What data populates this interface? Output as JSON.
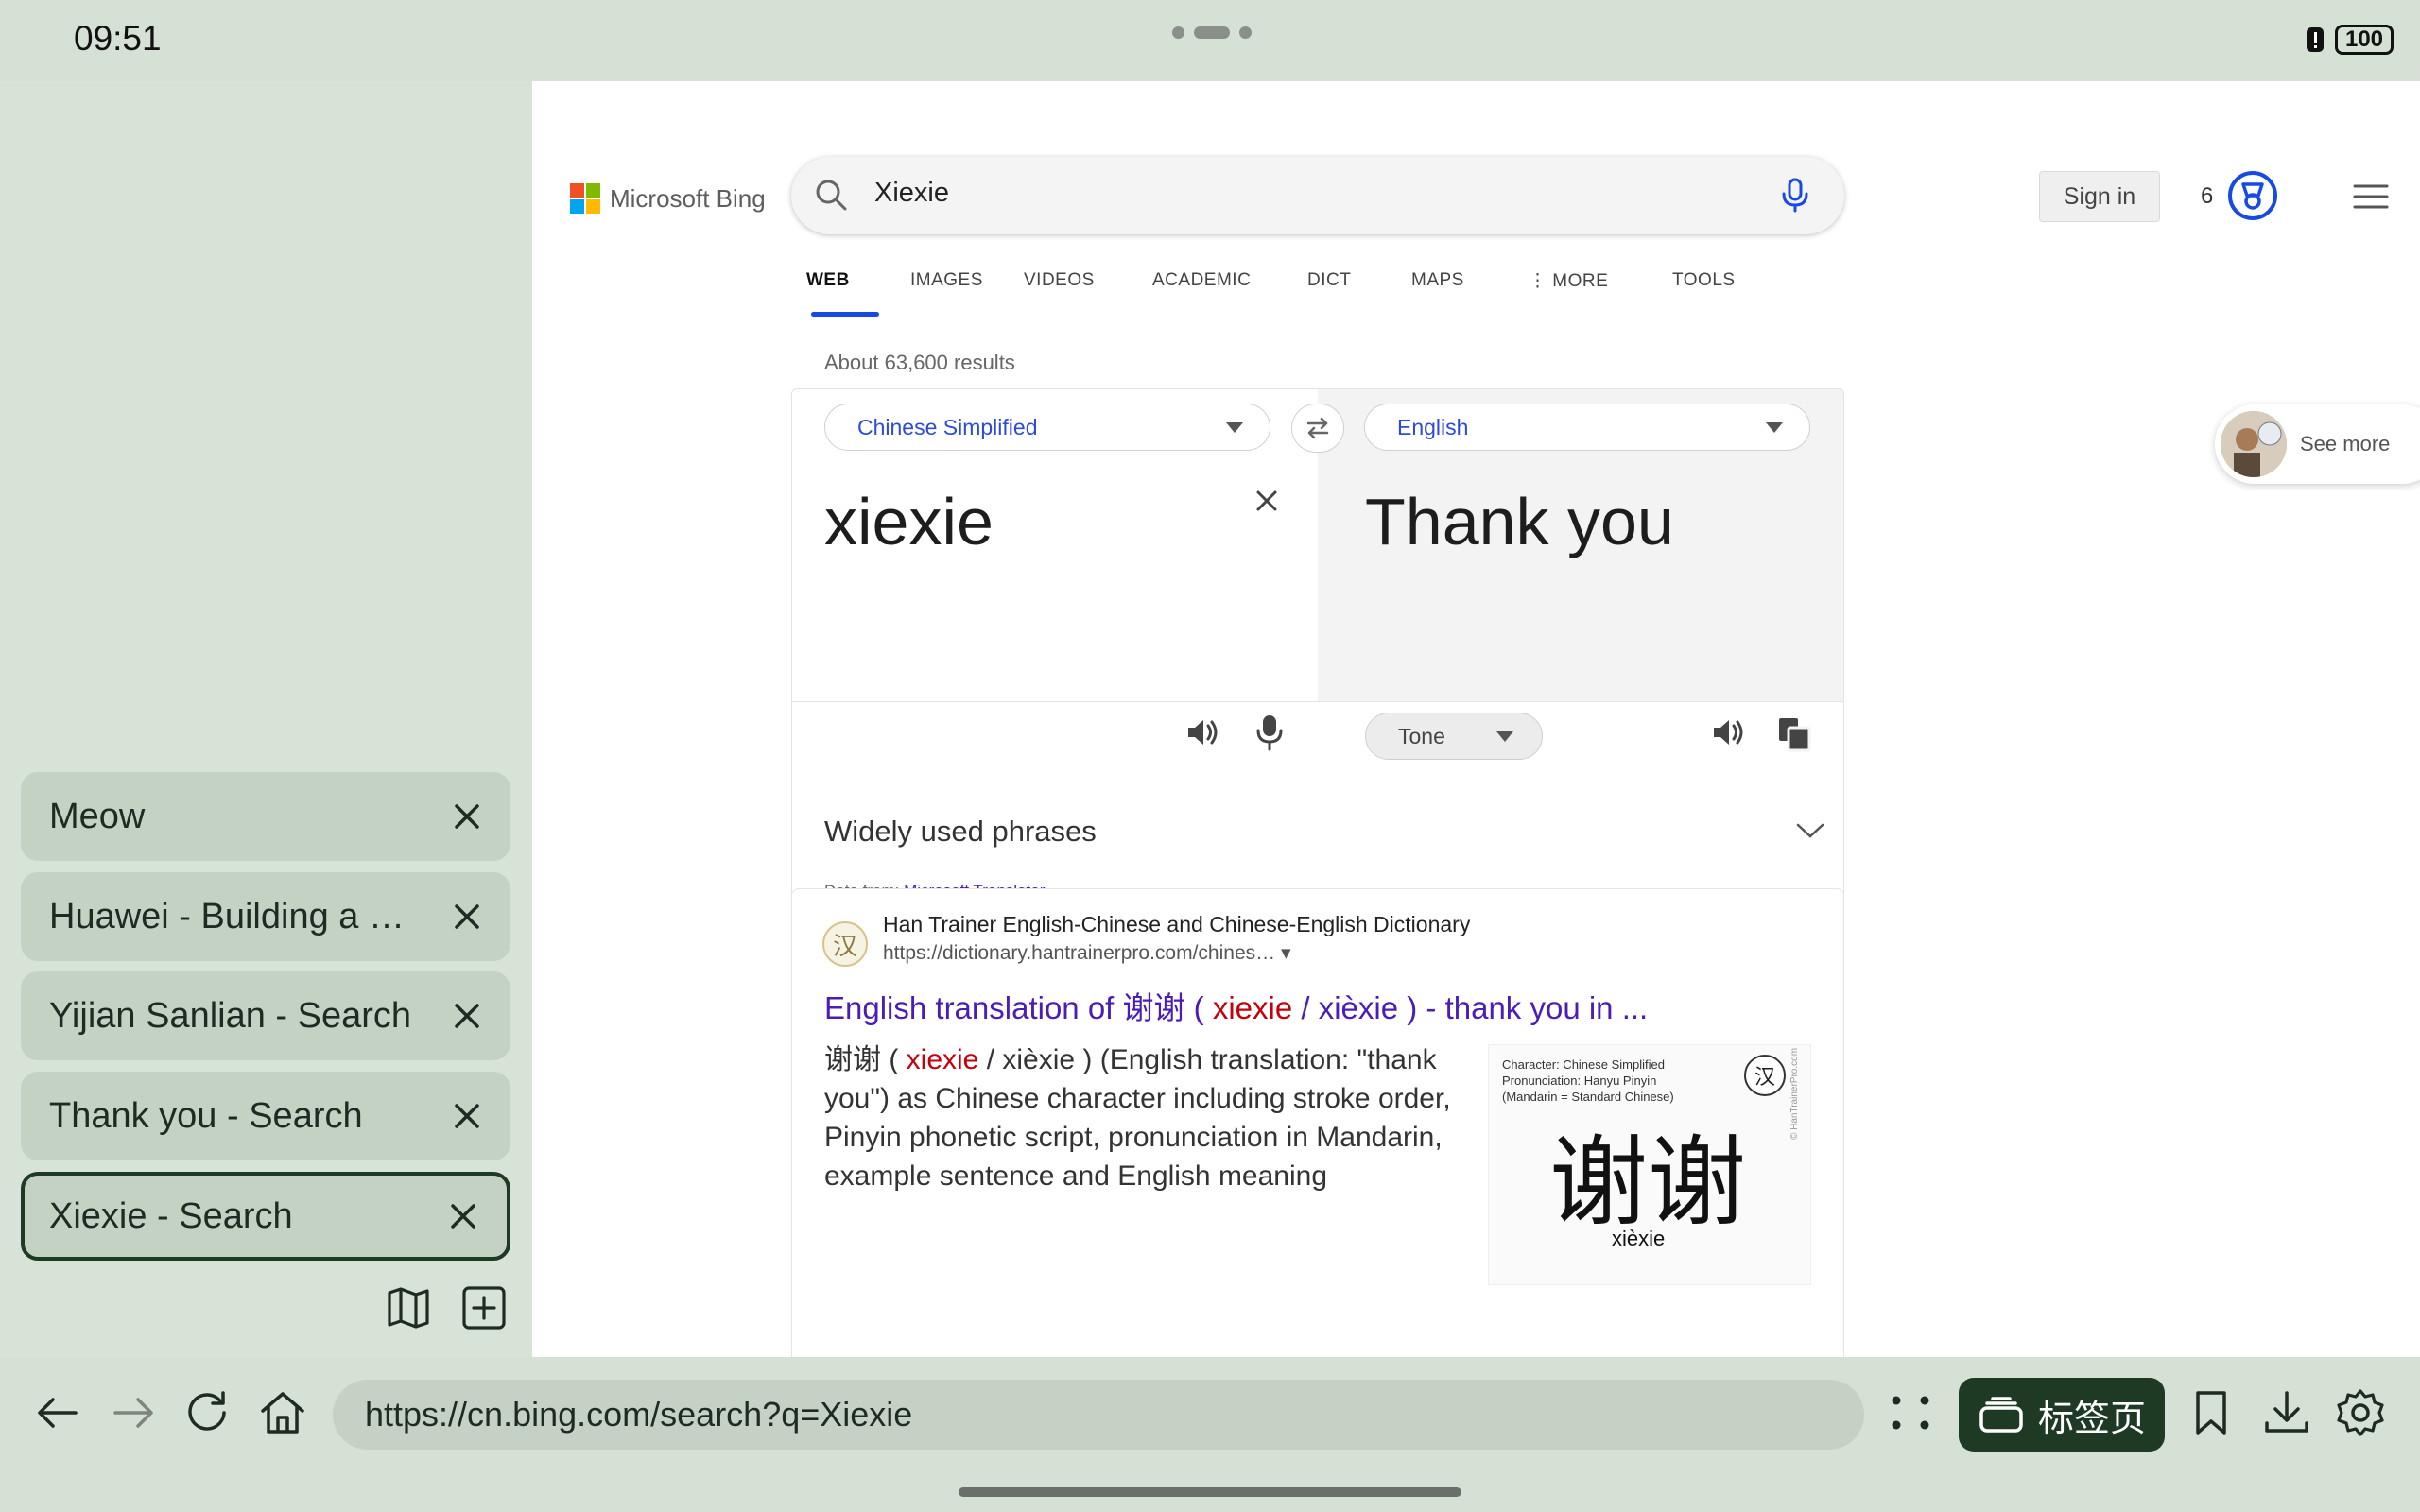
{
  "status": {
    "time": "09:51",
    "battery": "100"
  },
  "sidebar": {
    "tabs": [
      {
        "label": "Meow",
        "active": false
      },
      {
        "label": "Huawei - Building a …",
        "active": false
      },
      {
        "label": "Yijian Sanlian - Search",
        "active": false
      },
      {
        "label": "Thank you - Search",
        "active": false
      },
      {
        "label": "Xiexie - Search",
        "active": true
      }
    ],
    "buttons": [
      "map-icon",
      "add-tab-icon"
    ]
  },
  "bing": {
    "logo_text": "Microsoft Bing",
    "query": "Xiexie",
    "sign_in": "Sign in",
    "points": "6",
    "nav": [
      {
        "label": "WEB",
        "active": true
      },
      {
        "label": "IMAGES"
      },
      {
        "label": "VIDEOS"
      },
      {
        "label": "ACADEMIC"
      },
      {
        "label": "DICT"
      },
      {
        "label": "MAPS"
      },
      {
        "label": "⋮ MORE"
      },
      {
        "label": "TOOLS"
      }
    ],
    "results_count": "About 63,600 results",
    "translator": {
      "source_lang": "Chinese Simplified",
      "target_lang": "English",
      "source_text": "xiexie",
      "target_text": "Thank you",
      "tone_label": "Tone",
      "phrases_label": "Widely used phrases",
      "data_from_label": "Data from:",
      "data_from_source": "Microsoft Translator"
    },
    "see_more": "See more",
    "result": {
      "site_name": "Han Trainer English-Chinese and Chinese-English Dictionary",
      "site_url": "https://dictionary.hantrainerpro.com/chines… ▾",
      "title_pre": "English translation of 谢谢 ( ",
      "title_hl": "xiexie",
      "title_post": " / xièxie ) - thank you in ...",
      "snippet_pre": "谢谢 ( ",
      "snippet_hl": "xiexie",
      "snippet_post": " / xièxie ) (English translation: \"thank you\") as Chinese character including stroke order, Pinyin phonetic script, pronunciation in Mandarin, example sentence and English meaning",
      "thumb_caption": "Character: Chinese Simplified\nPronunciation: Hanyu Pinyin\n(Mandarin = Standard Chinese)",
      "thumb_char": "谢谢",
      "thumb_pinyin": "xièxie",
      "thumb_badge": "汉",
      "thumb_side": "© HanTrainerPro.com",
      "site_icon_char": "汉"
    }
  },
  "browser": {
    "url": "https://cn.bing.com/search?q=Xiexie",
    "tabs_button": "标签页"
  },
  "colors": {
    "accent": "#1e3a25",
    "link": "#4a1db8",
    "highlight": "#c4000b",
    "bing_blue": "#174ae4"
  }
}
